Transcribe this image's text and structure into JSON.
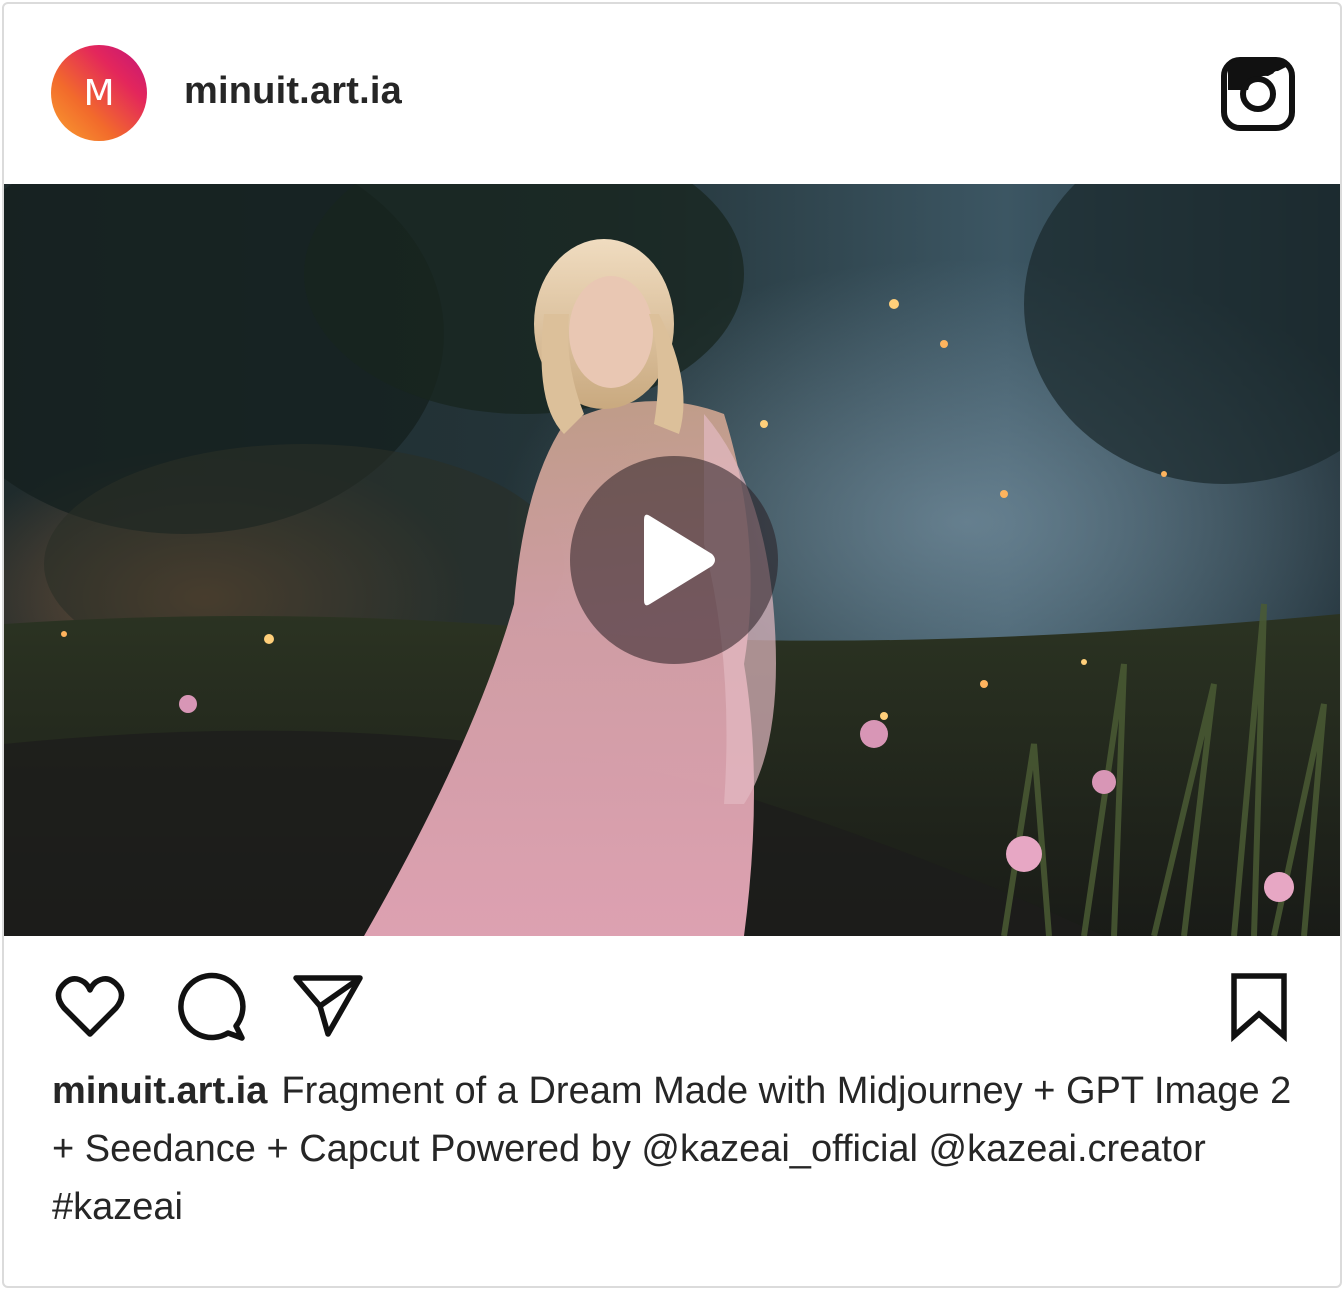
{
  "post": {
    "avatar_letter": "M",
    "username": "minuit.art.ia",
    "caption_user": "minuit.art.ia",
    "caption_text": "Fragment of a Dream Made with Midjourney + GPT Image 2 + Seedance + Capcut Powered by @kazeai_official @kazeai.creator #kazeai"
  },
  "icons": {
    "header_right": "instagram-icon",
    "media_overlay": "play-icon",
    "actions": [
      "heart-icon",
      "comment-icon",
      "share-icon",
      "bookmark-icon"
    ]
  },
  "colors": {
    "text": "#262626",
    "border": "#dbdbdb",
    "avatar_gradient": [
      "#f9a02f",
      "#e3265c",
      "#c0157a"
    ]
  }
}
